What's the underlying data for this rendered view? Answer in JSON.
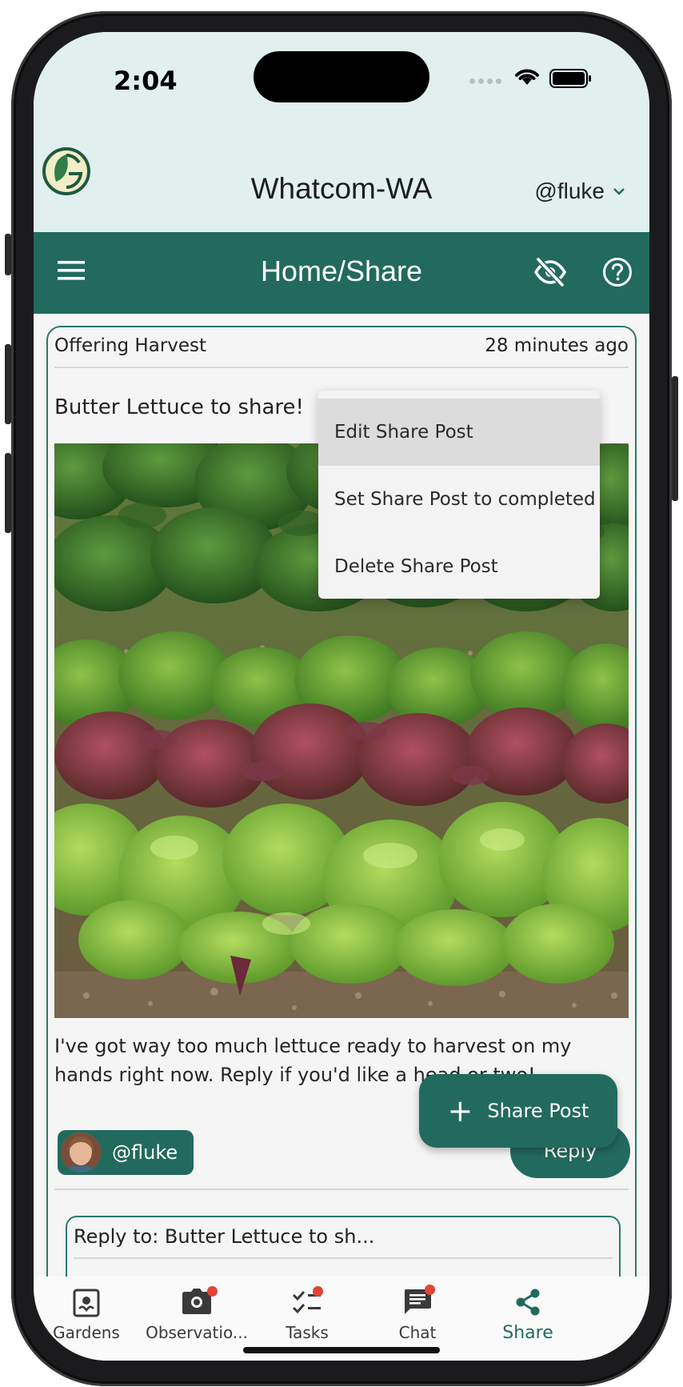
{
  "status_bar": {
    "time": "2:04"
  },
  "header": {
    "community": "Whatcom-WA",
    "username": "@fluke"
  },
  "toolbar": {
    "title": "Home/Share"
  },
  "post": {
    "type": "Offering Harvest",
    "time_ago": "28 minutes ago",
    "title": "Butter Lettuce to share!",
    "body": "I've got way too much lettuce ready to harvest on my hands right now. Reply if you'd like a head or two!",
    "author": "@fluke",
    "reply_label": "Reply"
  },
  "reply_preview": {
    "title": "Reply to: Butter Lettuce to sh..."
  },
  "popup_menu": {
    "items": [
      {
        "label": "Edit Share Post"
      },
      {
        "label": "Set Share Post to completed"
      },
      {
        "label": "Delete Share Post"
      }
    ]
  },
  "fab": {
    "label": "Share Post"
  },
  "bottom_nav": {
    "items": [
      {
        "label": "Gardens"
      },
      {
        "label": "Observatio..."
      },
      {
        "label": "Tasks"
      },
      {
        "label": "Chat"
      },
      {
        "label": "Share"
      }
    ]
  },
  "colors": {
    "primary": "#226a5e",
    "header_bg": "#e1f0ef",
    "badge": "#e04434"
  }
}
